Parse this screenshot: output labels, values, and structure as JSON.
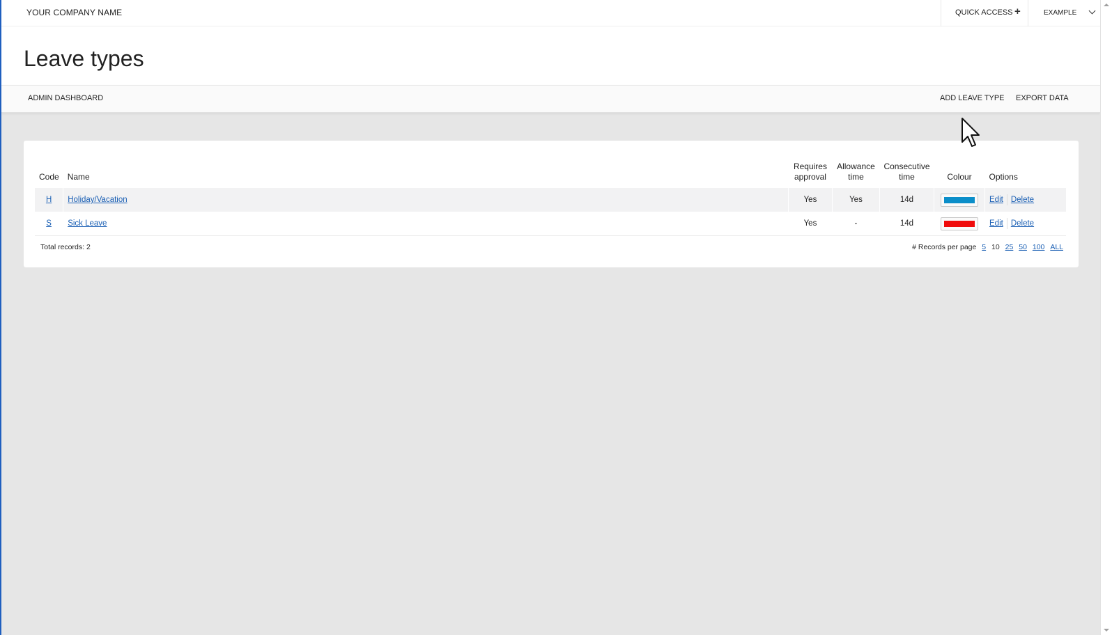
{
  "header": {
    "company": "YOUR COMPANY NAME",
    "quick_access_label": "QUICK ACCESS",
    "quick_access_icon": "plus-icon",
    "user_label": "EXAMPLE",
    "user_icon": "chevron-down-icon"
  },
  "page": {
    "title": "Leave types"
  },
  "subnav": {
    "admin_dashboard": "ADMIN DASHBOARD",
    "add_leave_type": "ADD LEAVE TYPE",
    "export_data": "EXPORT DATA"
  },
  "table": {
    "columns": {
      "code": "Code",
      "name": "Name",
      "requires_line1": "Requires",
      "requires_line2": "approval",
      "allowance_line1": "Allowance",
      "allowance_line2": "time",
      "consecutive_line1": "Consecutive",
      "consecutive_line2": "time",
      "colour": "Colour",
      "options": "Options"
    },
    "rows": [
      {
        "code": "H",
        "name": "Holiday/Vacation",
        "requires_approval": "Yes",
        "allowance_time": "Yes",
        "consecutive_time": "14d",
        "colour": "#0b8ec9",
        "edit": "Edit",
        "delete": "Delete"
      },
      {
        "code": "S",
        "name": "Sick Leave",
        "requires_approval": "Yes",
        "allowance_time": "-",
        "consecutive_time": "14d",
        "colour": "#f00b0b",
        "edit": "Edit",
        "delete": "Delete"
      }
    ],
    "total": "Total records: 2",
    "per_page": {
      "label": "# Records per page",
      "options": [
        "5",
        "10",
        "25",
        "50",
        "100",
        "ALL"
      ],
      "selected": "10"
    }
  }
}
